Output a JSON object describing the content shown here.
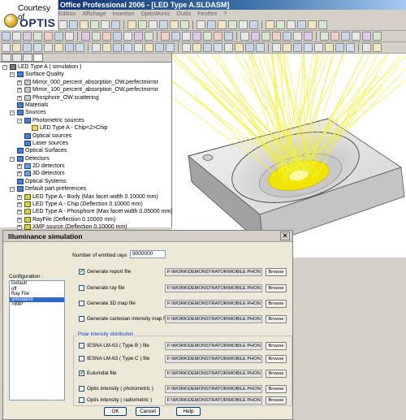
{
  "window": {
    "title": "SolidWorks Office Professional 2006 - [LED Type A.SLDASM]"
  },
  "logo": {
    "courtesy": "Courtesy of",
    "brand": "OPTIS"
  },
  "menu": [
    "Edition",
    "Affichage",
    "Insertion",
    "OptisWorks",
    "Outils",
    "Fenêtre",
    "?"
  ],
  "tree": {
    "items": [
      {
        "label": "LED Type A ( simulation )",
        "depth": 0,
        "expand": "−",
        "icon": "assembly-icon"
      },
      {
        "label": "Surface Quality",
        "depth": 1,
        "expand": "−",
        "icon": "folder-icon"
      },
      {
        "label": "Mirror_000_percent_absorption_OW.perfectmirror",
        "depth": 2,
        "expand": "+",
        "icon": "surface-icon"
      },
      {
        "label": "Mirror_100_percent_absorption_OW.perfectmirror",
        "depth": 2,
        "expand": "+",
        "icon": "surface-icon"
      },
      {
        "label": "Phosphore_OW.scattering",
        "depth": 2,
        "expand": "+",
        "icon": "surface-icon"
      },
      {
        "label": "Materials",
        "depth": 1,
        "expand": "",
        "icon": "folder-icon"
      },
      {
        "label": "Sources",
        "depth": 1,
        "expand": "−",
        "icon": "folder-icon"
      },
      {
        "label": "Photometric sources",
        "depth": 2,
        "expand": "−",
        "icon": "folder-icon"
      },
      {
        "label": "LED Type A - Chip<2>Chip",
        "depth": 3,
        "expand": "",
        "icon": "source-icon"
      },
      {
        "label": "Optical sources",
        "depth": 2,
        "expand": "",
        "icon": "folder-icon"
      },
      {
        "label": "Laser sources",
        "depth": 2,
        "expand": "",
        "icon": "folder-icon"
      },
      {
        "label": "Optical Surfaces",
        "depth": 1,
        "expand": "",
        "icon": "folder-icon"
      },
      {
        "label": "Detectors",
        "depth": 1,
        "expand": "−",
        "icon": "folder-icon"
      },
      {
        "label": "2D detectors",
        "depth": 2,
        "expand": "+",
        "icon": "detector-icon"
      },
      {
        "label": "3D detectors",
        "depth": 2,
        "expand": "+",
        "icon": "detector-icon"
      },
      {
        "label": "Optical Systems",
        "depth": 1,
        "expand": "",
        "icon": "folder-icon"
      },
      {
        "label": "Default part preferences",
        "depth": 1,
        "expand": "−",
        "icon": "folder-icon"
      },
      {
        "label": "LED Type A - Body (Max facet width 0.10000 mm)",
        "depth": 2,
        "expand": "+",
        "icon": "part-icon"
      },
      {
        "label": "LED Type A - Chip (Deflection 0.10000 mm)",
        "depth": 2,
        "expand": "+",
        "icon": "part-icon"
      },
      {
        "label": "LED Type A - Phosphore (Max facet width 0.05000 mm)",
        "depth": 2,
        "expand": "+",
        "icon": "part-icon"
      },
      {
        "label": "RayFile (Deflection 0.10000 mm)",
        "depth": 2,
        "expand": "+",
        "icon": "part-icon"
      },
      {
        "label": "XMP source (Deflection 0.10000 mm)",
        "depth": 2,
        "expand": "+",
        "icon": "part-icon"
      }
    ]
  },
  "dialog": {
    "title": "Illuminance simulation",
    "rays_label": "Number of emitted rays",
    "rays_value": "9000000",
    "config_label": "Configuration :",
    "configs": [
      "Default",
      "off",
      "Ray File",
      "simulation",
      ">IMP"
    ],
    "selected_config": "simulation",
    "options": [
      {
        "label": "Generate report file",
        "checked": true,
        "path": "F:\\WORK\\DEMONSTRATOR\\MOBILE PHON",
        "browse": "Browse"
      },
      {
        "label": "Generate ray file",
        "checked": false,
        "path": "F:\\WORK\\DEMONSTRATOR\\MOBILE PHON",
        "browse": "Browse"
      },
      {
        "label": "Generate 3D map file",
        "checked": false,
        "path": "F:\\WORK\\DEMONSTRATOR\\MOBILE PHON",
        "browse": "Browse"
      },
      {
        "label": "Generate cartesian intensity map file",
        "checked": false,
        "path": "F:\\WORK\\DEMONSTRATOR\\MOBILE PHON",
        "browse": "Browse"
      }
    ],
    "polar_group_label": "Polar intensity distribution",
    "polar_options": [
      {
        "label": "IESNA LM-63 ( Type B ) file",
        "checked": false,
        "path": "F:\\WORK\\DEMONSTRATOR\\MOBILE PHON",
        "browse": "Browse"
      },
      {
        "label": "IESNA LM-63 ( Type C ) file",
        "checked": false,
        "path": "F:\\WORK\\DEMONSTRATOR\\MOBILE PHON",
        "browse": "Browse"
      },
      {
        "label": "Eulumdat file",
        "checked": true,
        "path": "F:\\WORK\\DEMONSTRATOR\\MOBILE PHON",
        "browse": "Browse"
      },
      {
        "label": "Optis intensity ( photometric )",
        "checked": false,
        "path": "F:\\WORK\\DEMONSTRATOR\\MOBILE PHON",
        "browse": "Browse"
      },
      {
        "label": "Optis intensity ( radiometric )",
        "checked": false,
        "path": "F:\\WORK\\DEMONSTRATOR\\MOBILE PHON",
        "browse": "Browse"
      }
    ],
    "buttons": {
      "ok": "OK",
      "cancel": "Cancel",
      "help": "Help"
    }
  },
  "colors": {
    "ray": "#f2f23a",
    "emitter": "#f0e400",
    "part_face_top": "#e6e6e6",
    "part_face_front": "#c2c2c2",
    "part_face_side": "#9a9a9a"
  }
}
